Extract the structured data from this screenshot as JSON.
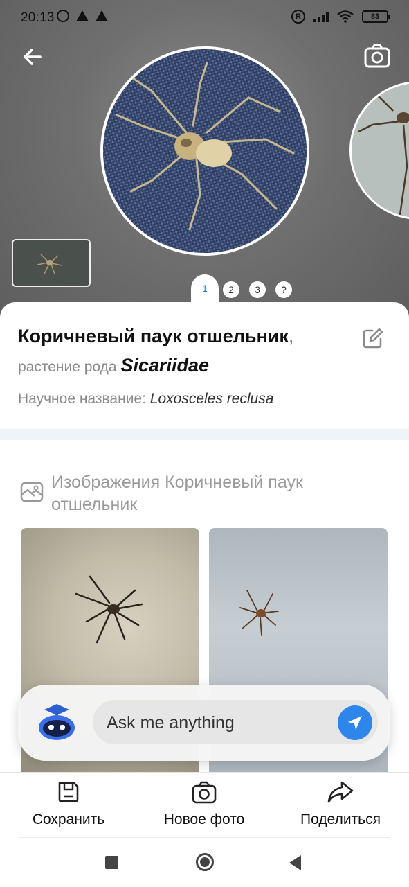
{
  "status_bar": {
    "time": "20:13",
    "battery": "83"
  },
  "photo_pager": {
    "active": "1",
    "pages": [
      "2",
      "3",
      "?"
    ]
  },
  "species": {
    "common_name": "Коричневый паук отшельник",
    "comma": ",",
    "genus_prefix": "растение рода",
    "genus": "Sicariidae",
    "scientific_label": "Научное название:",
    "scientific_name": "Loxosceles reclusa"
  },
  "images_section": {
    "title": "Изображения Коричневый паук отшельник"
  },
  "assistant": {
    "placeholder": "Ask me anything"
  },
  "toolbar": {
    "save_label": "Сохранить",
    "new_photo_label": "Новое фото",
    "share_label": "Поделиться"
  },
  "colors": {
    "accent": "#2e86ea",
    "separator": "#eef4f8"
  },
  "icons": [
    "back-arrow-icon",
    "camera-icon",
    "edit-icon",
    "gallery-icon",
    "bot-avatar-icon",
    "send-icon",
    "save-icon",
    "share-icon"
  ]
}
